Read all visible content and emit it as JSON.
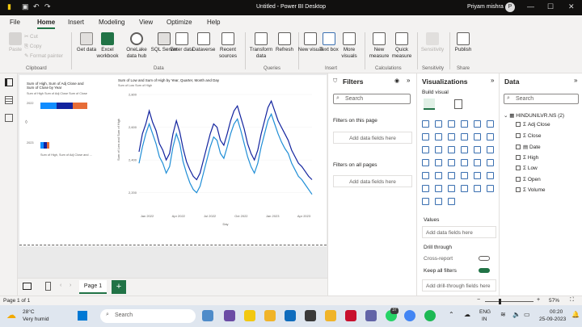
{
  "window": {
    "title": "Untitled - Power BI Desktop",
    "user": "Priyam mishra",
    "avatar_initial": "P"
  },
  "menu": [
    "File",
    "Home",
    "Insert",
    "Modeling",
    "View",
    "Optimize",
    "Help"
  ],
  "active_menu": "Home",
  "ribbon": {
    "clipboard": {
      "paste": "Paste",
      "cut": "Cut",
      "copy": "Copy",
      "format_painter": "Format painter",
      "group": "Clipboard"
    },
    "data": {
      "get_data": "Get data",
      "excel": "Excel workbook",
      "onelake": "OneLake data hub",
      "sql": "SQL Server",
      "enter": "Enter data",
      "dataverse": "Dataverse",
      "recent": "Recent sources",
      "group": "Data"
    },
    "queries": {
      "transform": "Transform data",
      "refresh": "Refresh",
      "group": "Queries"
    },
    "insert": {
      "new_visual": "New visual",
      "text_box": "Text box",
      "more_visuals": "More visuals",
      "group": "Insert"
    },
    "calculations": {
      "new_measure": "New measure",
      "quick_measure": "Quick measure",
      "group": "Calculations"
    },
    "sensitivity": {
      "label": "Sensitivity",
      "group": "Sensitivity"
    },
    "share": {
      "publish": "Publish",
      "group": "Share"
    }
  },
  "visual1": {
    "title_line1": "Sum of High, Sum of Adj Close and",
    "title_line2": "Sum of Close by Year",
    "legend": "Sum of High  Sum of Adj Close  Sum of Close",
    "y_label1": "2022",
    "y_label2": "2023",
    "x_axis": "Sum of High, Sum of Adj Close and ...",
    "marker": "◊"
  },
  "visual2": {
    "title": "Sum of Low and Sum of High by Year, Quarter, Month and Day",
    "legend": "Sum of Low  Sum of High",
    "y_axis": "Sum of Low and Sum of High",
    "x_axis": "Day",
    "y_ticks": [
      "2,800",
      "2,600",
      "2,400",
      "2,200"
    ],
    "x_ticks": [
      "Jan 2022",
      "Apr 2022",
      "Jul 2022",
      "Oct 2022",
      "Jan 2023",
      "Apr 2023"
    ]
  },
  "filters": {
    "title": "Filters",
    "search": "Search",
    "on_page": "Filters on this page",
    "on_all": "Filters on all pages",
    "add_fields": "Add data fields here"
  },
  "viz_pane": {
    "title": "Visualizations",
    "build": "Build visual",
    "values": "Values",
    "add_fields": "Add data fields here",
    "drillthrough": "Drill through",
    "cross_report": "Cross-report",
    "cross_state": "Off",
    "keep_filters": "Keep all filters",
    "keep_state": "On",
    "add_drill": "Add drill-through fields here"
  },
  "data_pane": {
    "title": "Data",
    "search": "Search",
    "table": "HINDUNILVR.NS (2)",
    "fields": [
      "Adj Close",
      "Close",
      "Date",
      "High",
      "Low",
      "Open",
      "Volume"
    ]
  },
  "pages": {
    "tab": "Page 1",
    "add": "+"
  },
  "status": {
    "page": "Page 1 of 1",
    "zoom": "57%"
  },
  "taskbar": {
    "temp": "28°C",
    "weather": "Very humid",
    "search": "Search",
    "lang1": "ENG",
    "lang2": "IN",
    "time": "00:20",
    "date": "25-09-2023",
    "badge": "37"
  },
  "chart_data": [
    {
      "type": "bar",
      "title": "Sum of High, Sum of Adj Close and Sum of Close by Year",
      "categories": [
        "2022",
        "2023"
      ],
      "series": [
        {
          "name": "Sum of High"
        },
        {
          "name": "Sum of Adj Close"
        },
        {
          "name": "Sum of Close"
        }
      ],
      "orientation": "horizontal",
      "stacked": true
    },
    {
      "type": "line",
      "title": "Sum of Low and Sum of High by Year, Quarter, Month and Day",
      "xlabel": "Day",
      "ylabel": "Sum of Low and Sum of High",
      "yticks": [
        "2,800",
        "2,600",
        "2,400",
        "2,200"
      ],
      "xticks": [
        "Jan 2022",
        "Apr 2022",
        "Jul 2022",
        "Oct 2022",
        "Jan 2023",
        "Apr 2023"
      ],
      "ylim": [
        2100,
        2800
      ],
      "series": [
        {
          "name": "Sum of Low",
          "color": "#1f8ed6"
        },
        {
          "name": "Sum of High",
          "color": "#12239e"
        }
      ],
      "high": [
        2450,
        2560,
        2620,
        2700,
        2630,
        2580,
        2500,
        2460,
        2400,
        2440,
        2560,
        2640,
        2570,
        2470,
        2390,
        2340,
        2300,
        2280,
        2320,
        2400,
        2480,
        2560,
        2620,
        2600,
        2520,
        2490,
        2560,
        2640,
        2700,
        2730,
        2660,
        2590,
        2500,
        2440,
        2400,
        2460,
        2560,
        2640,
        2720,
        2760,
        2700,
        2640,
        2600,
        2560,
        2520,
        2460,
        2420,
        2380,
        2360,
        2330,
        2300,
        2280
      ],
      "low": [
        2380,
        2480,
        2560,
        2620,
        2560,
        2500,
        2420,
        2380,
        2320,
        2360,
        2480,
        2560,
        2500,
        2390,
        2320,
        2260,
        2220,
        2200,
        2240,
        2320,
        2400,
        2480,
        2540,
        2520,
        2440,
        2410,
        2480,
        2560,
        2620,
        2650,
        2580,
        2500,
        2420,
        2360,
        2320,
        2380,
        2480,
        2560,
        2640,
        2680,
        2620,
        2560,
        2510,
        2470,
        2440,
        2380,
        2340,
        2300,
        2280,
        2250,
        2220,
        2190
      ]
    }
  ],
  "colors": {
    "accent": "#217346",
    "bar1": "#118dff",
    "bar2": "#12239e",
    "bar3": "#e66c37",
    "low": "#1f8ed6",
    "high": "#12239e"
  }
}
